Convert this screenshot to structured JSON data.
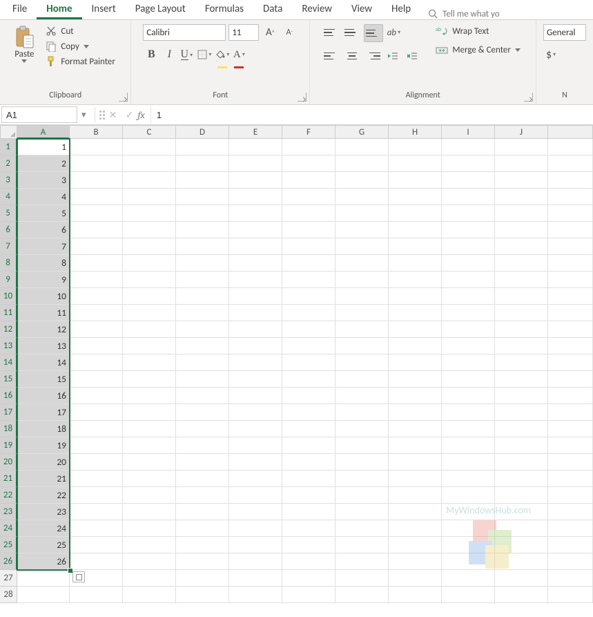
{
  "tabs": {
    "file": "File",
    "home": "Home",
    "insert": "Insert",
    "pagelayout": "Page Layout",
    "formulas": "Formulas",
    "data": "Data",
    "review": "Review",
    "view": "View",
    "help": "Help"
  },
  "tellme": "Tell me what yo",
  "clipboard": {
    "paste": "Paste",
    "cut": "Cut",
    "copy": "Copy",
    "formatpainter": "Format Painter",
    "group": "Clipboard"
  },
  "font": {
    "name": "Calibri",
    "size": "11",
    "group": "Font",
    "bold": "B",
    "italic": "I",
    "underline": "U",
    "fillcolor": "#ffe066",
    "fontcolor": "#d92b2b"
  },
  "alignment": {
    "group": "Alignment",
    "wrap": "Wrap Text",
    "merge": "Merge & Center"
  },
  "number": {
    "group": "N",
    "format": "General",
    "currency": "$"
  },
  "namebox": "A1",
  "formula": "1",
  "columns": [
    "A",
    "B",
    "C",
    "D",
    "E",
    "F",
    "G",
    "H",
    "I",
    "J"
  ],
  "col_widths": {
    "A": 76,
    "other": 77
  },
  "selected_column": "A",
  "selected_rows": [
    1,
    26
  ],
  "active_cell": "A1",
  "row_count": 28,
  "cells": {
    "A1": "1",
    "A2": "2",
    "A3": "3",
    "A4": "4",
    "A5": "5",
    "A6": "6",
    "A7": "7",
    "A8": "8",
    "A9": "9",
    "A10": "10",
    "A11": "11",
    "A12": "12",
    "A13": "13",
    "A14": "14",
    "A15": "15",
    "A16": "16",
    "A17": "17",
    "A18": "18",
    "A19": "19",
    "A20": "20",
    "A21": "21",
    "A22": "22",
    "A23": "23",
    "A24": "24",
    "A25": "25",
    "A26": "26"
  },
  "watermark": "MyWindowsHub.com"
}
